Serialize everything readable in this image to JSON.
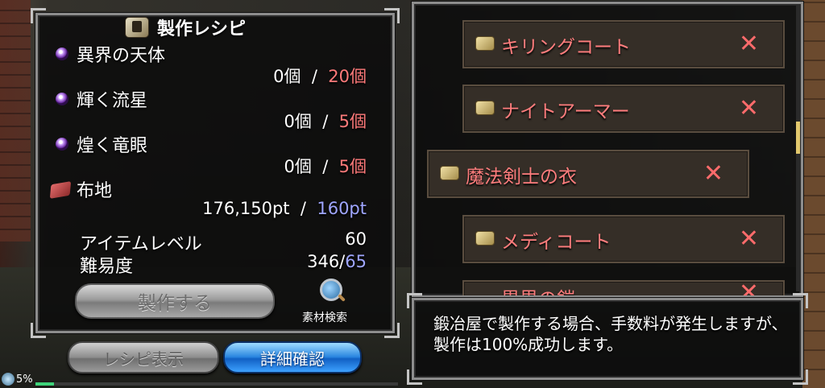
{
  "recipe": {
    "title": "製作レシピ",
    "materials": [
      {
        "name": "異界の天体",
        "have": "0個",
        "sep": "/",
        "need": "20個"
      },
      {
        "name": "輝く流星",
        "have": "0個",
        "sep": "/",
        "need": "5個"
      },
      {
        "name": "煌く竜眼",
        "have": "0個",
        "sep": "/",
        "need": "5個"
      },
      {
        "name": "布地",
        "have": "176,150pt",
        "sep": "/",
        "need": "160pt"
      }
    ],
    "item_level_label": "アイテムレベル",
    "item_level_value": "60",
    "difficulty_label": "難易度",
    "difficulty_current": "346/",
    "difficulty_max": "65",
    "craft_label": "製作する",
    "search_label": "素材検索"
  },
  "buttons": {
    "recipe_view": "レシピ表示",
    "detail": "詳細確認"
  },
  "list": {
    "items": [
      {
        "name": "キリングコート"
      },
      {
        "name": "ナイトアーマー"
      },
      {
        "name": "魔法剣士の衣"
      },
      {
        "name": "メディコート"
      },
      {
        "name": "異界の鎧"
      }
    ],
    "remove_symbol": "✕"
  },
  "message": {
    "text": "鍛冶屋で製作する場合、手数料が発生しますが、製作は100%成功します。"
  },
  "status": {
    "percent_text": "5%",
    "progress": 0.05
  },
  "colors": {
    "required_red": "#ff7a7a",
    "available_blue": "#9fa6ff",
    "item_name": "#ff7d7d",
    "detail_button": "#2a86e0"
  }
}
